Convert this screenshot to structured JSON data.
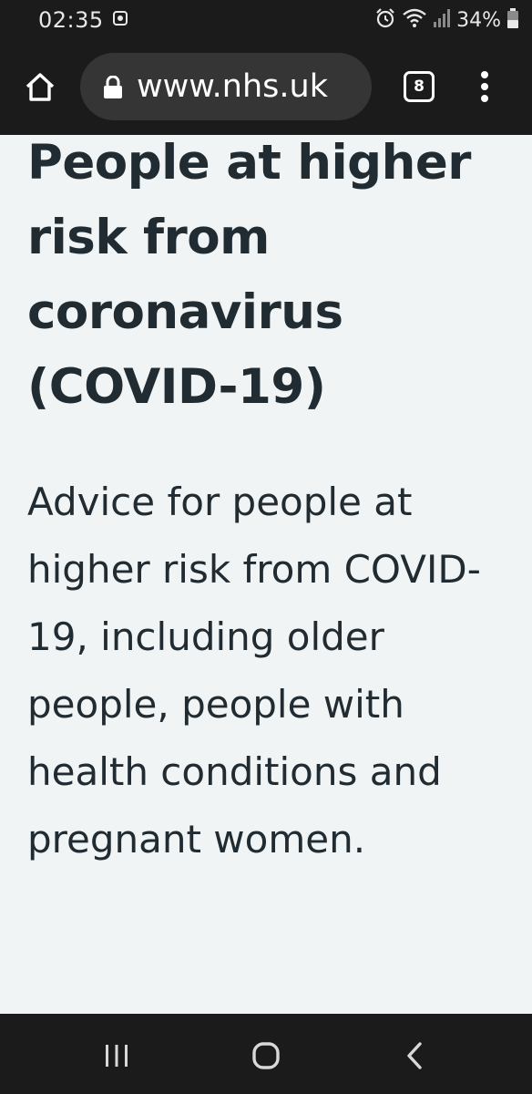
{
  "status_bar": {
    "time": "02:35",
    "battery": "34%"
  },
  "browser": {
    "url": "www.nhs.uk",
    "tab_count": "8"
  },
  "page": {
    "title": "People at higher risk from coronavirus (COVID-19)",
    "lede": "Advice for people at higher risk from COVID-19, including older people, people with health conditions and pregnant women."
  },
  "icons": {
    "home": "home-icon",
    "lock": "lock-icon",
    "menu": "more-vert-icon",
    "alarm": "alarm-icon",
    "wifi": "wifi-icon",
    "signal": "signal-icon",
    "battery": "battery-icon",
    "recents": "recents-icon",
    "nav_home": "nav-home-icon",
    "back": "back-icon"
  }
}
